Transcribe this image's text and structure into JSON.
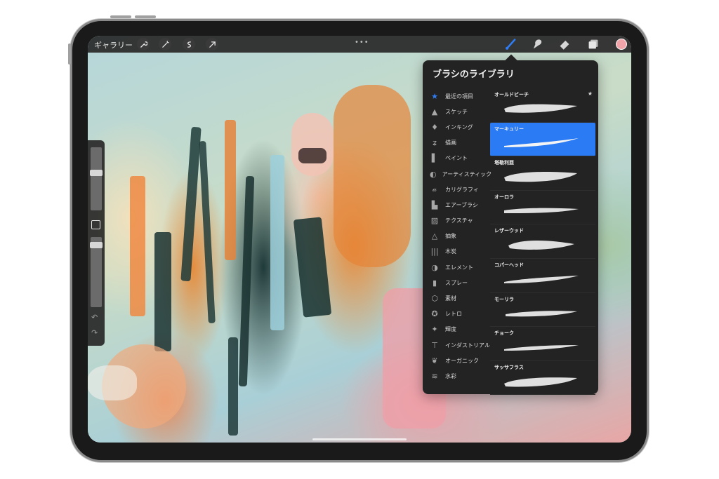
{
  "topbar": {
    "gallery_label": "ギャラリー",
    "left_tools": [
      "wrench-icon",
      "magic-wand-icon",
      "selection-icon",
      "transform-arrow-icon"
    ],
    "right_tools": [
      "brush-icon",
      "smudge-icon",
      "eraser-icon",
      "layers-icon"
    ],
    "more_dots": "•••",
    "active_tool": "brush-icon",
    "current_color": "#f0a3a8"
  },
  "sidebar": {
    "items": [
      "brush-size-slider",
      "modify-button",
      "opacity-slider",
      "undo-icon",
      "redo-icon"
    ]
  },
  "panel": {
    "title": "ブラシのライブラリ",
    "categories": [
      {
        "label": "最近の項目",
        "icon": "star-icon",
        "glyph": "★"
      },
      {
        "label": "スケッチ",
        "icon": "pencil-tip-icon",
        "glyph": "▲"
      },
      {
        "label": "インキング",
        "icon": "ink-drop-icon",
        "glyph": "♦"
      },
      {
        "label": "描画",
        "icon": "swirl-icon",
        "glyph": "ʑ"
      },
      {
        "label": "ペイント",
        "icon": "paint-brush-icon",
        "glyph": "▌"
      },
      {
        "label": "アーティスティック",
        "icon": "palette-icon",
        "glyph": "◐"
      },
      {
        "label": "カリグラフィ",
        "icon": "calligraphy-icon",
        "glyph": "𝒶"
      },
      {
        "label": "エアーブラシ",
        "icon": "airbrush-icon",
        "glyph": "▙"
      },
      {
        "label": "テクスチャ",
        "icon": "texture-icon",
        "glyph": "▨"
      },
      {
        "label": "抽象",
        "icon": "triangle-icon",
        "glyph": "△"
      },
      {
        "label": "木炭",
        "icon": "charcoal-icon",
        "glyph": "|||"
      },
      {
        "label": "エレメント",
        "icon": "yin-yang-icon",
        "glyph": "◑"
      },
      {
        "label": "スプレー",
        "icon": "spray-can-icon",
        "glyph": "▮"
      },
      {
        "label": "素材",
        "icon": "cube-icon",
        "glyph": "⬡"
      },
      {
        "label": "レトロ",
        "icon": "retro-star-icon",
        "glyph": "✪"
      },
      {
        "label": "輝度",
        "icon": "sparkle-icon",
        "glyph": "✦"
      },
      {
        "label": "インダストリアル",
        "icon": "anvil-icon",
        "glyph": "⊤"
      },
      {
        "label": "オーガニック",
        "icon": "leaf-icon",
        "glyph": "❦"
      },
      {
        "label": "水彩",
        "icon": "water-waves-icon",
        "glyph": "≋"
      }
    ],
    "selected_category": "最近の項目",
    "brushes": [
      {
        "name": "オールドビーチ",
        "starred": true
      },
      {
        "name": "マーキュリー",
        "starred": false
      },
      {
        "name": "塔勒利亜",
        "starred": false
      },
      {
        "name": "オーロラ",
        "starred": false
      },
      {
        "name": "レザーウッド",
        "starred": false
      },
      {
        "name": "コパーヘッド",
        "starred": false
      },
      {
        "name": "モーリラ",
        "starred": false
      },
      {
        "name": "チョーク",
        "starred": false
      },
      {
        "name": "サッサフラス",
        "starred": false
      }
    ],
    "selected_brush": "マーキュリー",
    "star_glyph": "★"
  },
  "colors": {
    "accent": "#2a7bf4",
    "panel_bg": "#232323",
    "toolbar_bg": "#282828"
  }
}
